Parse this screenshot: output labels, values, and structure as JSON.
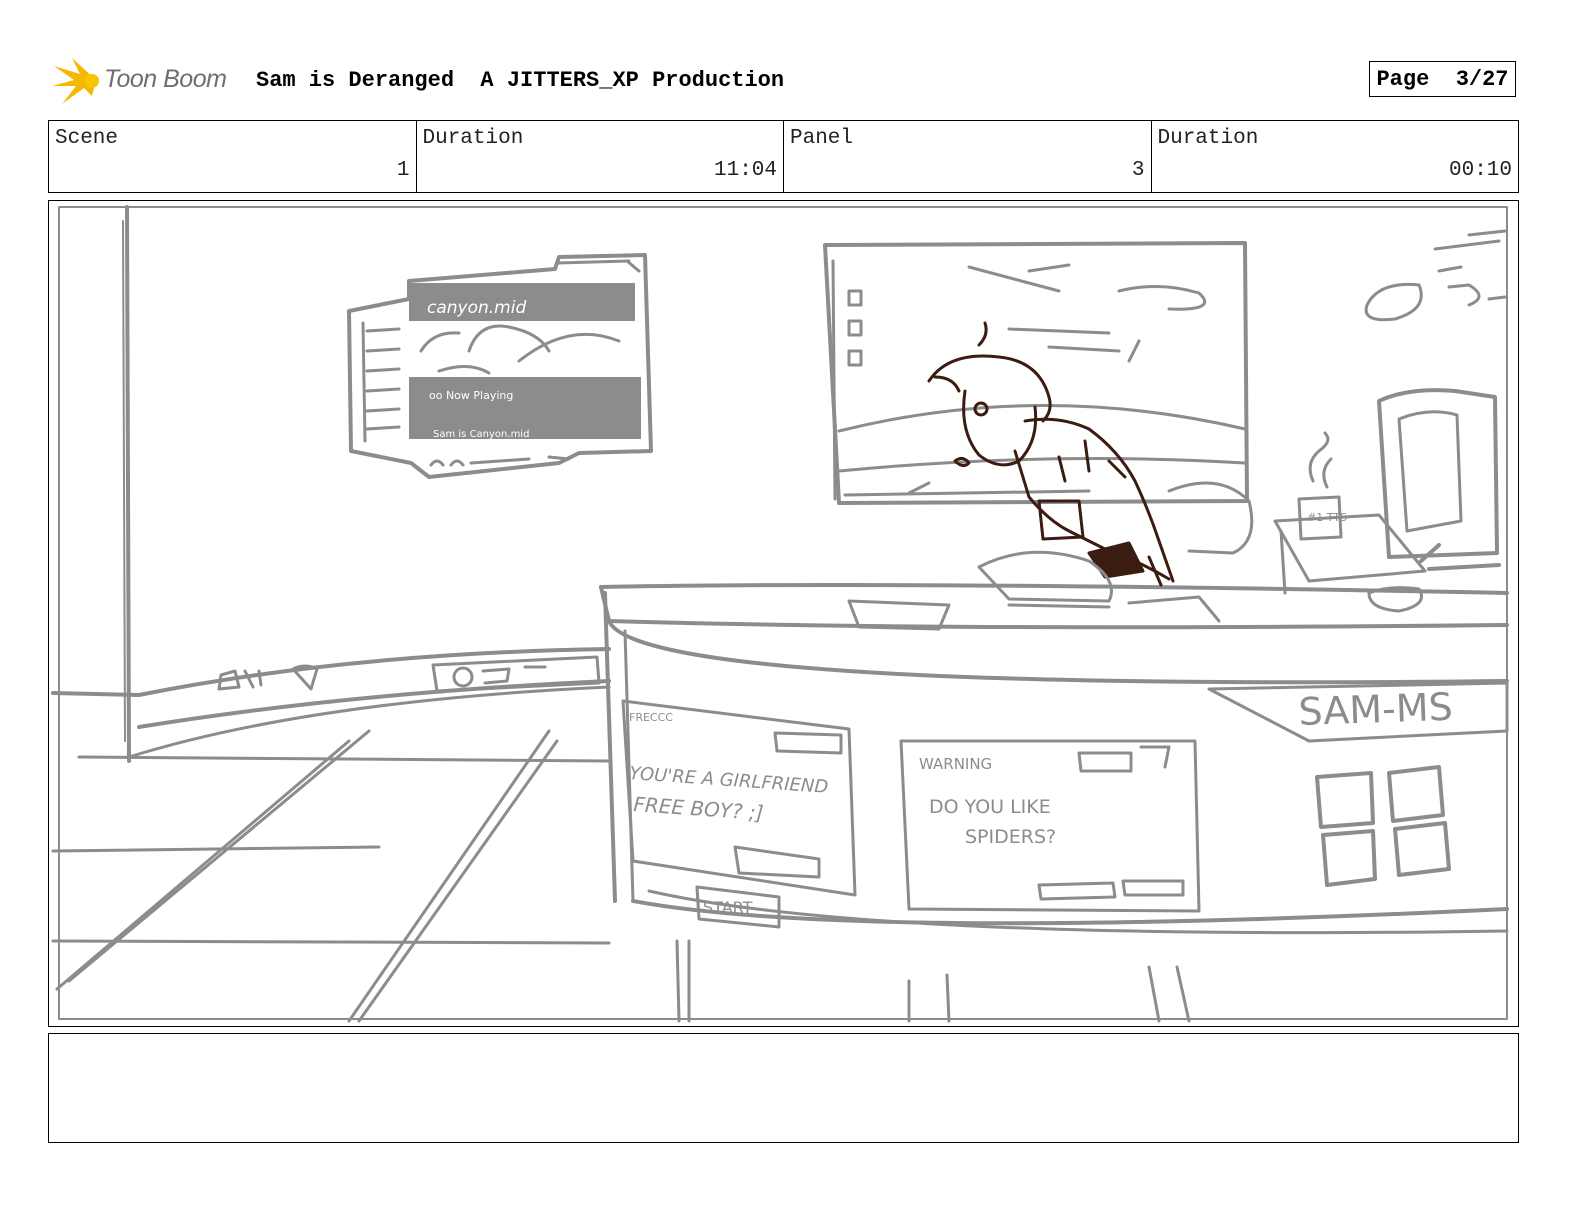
{
  "header": {
    "logo_text": "Toon Boom",
    "project_title": "Sam is Deranged  A JITTERS_XP Production",
    "page_label": "Page  3/27"
  },
  "info": {
    "scene_label": "Scene",
    "scene_value": "1",
    "scene_duration_label": "Duration",
    "scene_duration_value": "11:04",
    "panel_label": "Panel",
    "panel_value": "3",
    "panel_duration_label": "Duration",
    "panel_duration_value": "00:10"
  },
  "sketch": {
    "media_window_title": "canyon.mid",
    "media_now_playing": "oo  Now Playing",
    "media_status": "Sam is Canyon.mid",
    "mug_text": "#1 TTS",
    "popup1_title": "FRECCC",
    "popup1_text_line1": "YOU'RE A GIRLFRIEND",
    "popup1_text_line2": "FREE BOY? ;]",
    "popup2_title": "WARNING",
    "popup2_text_line1": "DO YOU LIKE",
    "popup2_text_line2": "SPIDERS?",
    "desk_brand": "SAM-MS",
    "start_label": "START",
    "colors": {
      "sketch_line": "#8c8c8c",
      "character_line": "#3b1c10",
      "logo_yellow": "#f5b800"
    }
  },
  "notes": {
    "text": ""
  }
}
